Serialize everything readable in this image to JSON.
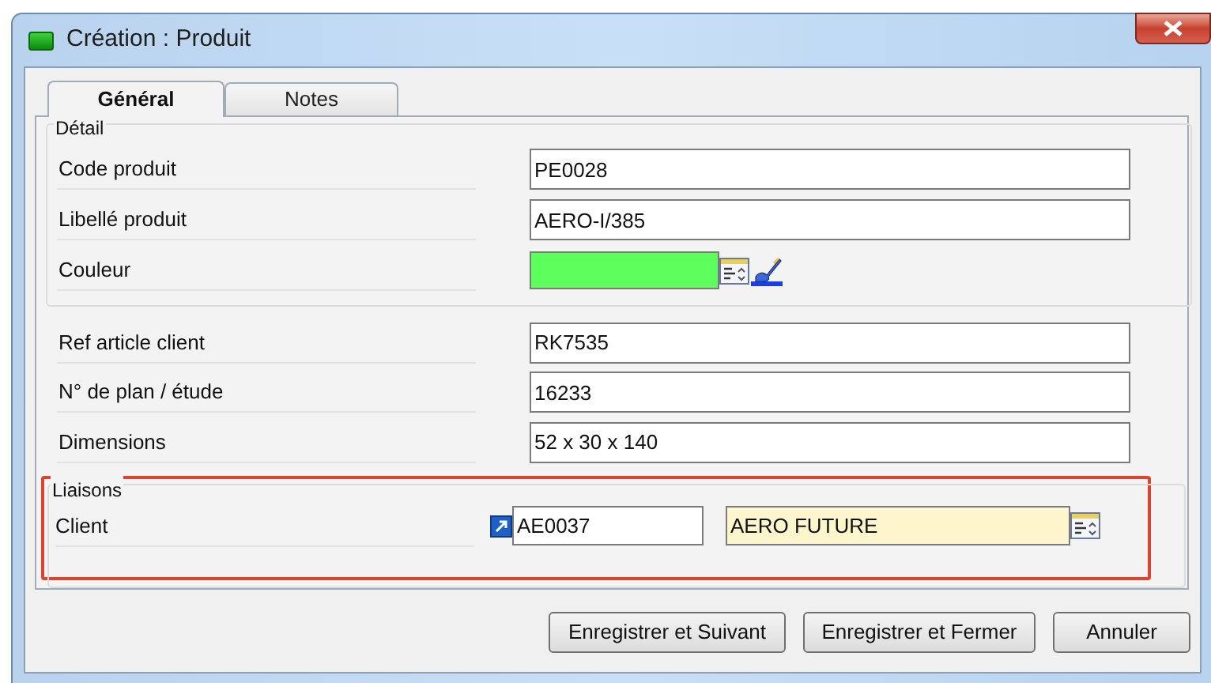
{
  "window": {
    "title": "Création : Produit"
  },
  "tabs": [
    {
      "label": "Général",
      "selected": true
    },
    {
      "label": "Notes",
      "selected": false
    }
  ],
  "detail": {
    "title": "Détail",
    "fields": [
      {
        "label": "Code produit",
        "kind": "text",
        "value": "PE0028"
      },
      {
        "label": "Libellé produit",
        "kind": "text",
        "value": "AERO-I/385"
      },
      {
        "label": "Couleur",
        "kind": "color",
        "color": "#5cff5c"
      }
    ]
  },
  "fields": [
    {
      "label": "Ref article client",
      "kind": "text",
      "value": "RK7535"
    },
    {
      "label": "N° de plan / étude",
      "kind": "text",
      "value": "16233"
    },
    {
      "label": "Dimensions",
      "kind": "text",
      "value": "52 x 30 x 140"
    }
  ],
  "liaisons": {
    "title": "Liaisons",
    "client": {
      "label": "Client",
      "code": "AE0037",
      "name": "AERO FUTURE"
    }
  },
  "buttons": [
    "Enregistrer et Suivant",
    "Enregistrer et Fermer",
    "Annuler"
  ]
}
